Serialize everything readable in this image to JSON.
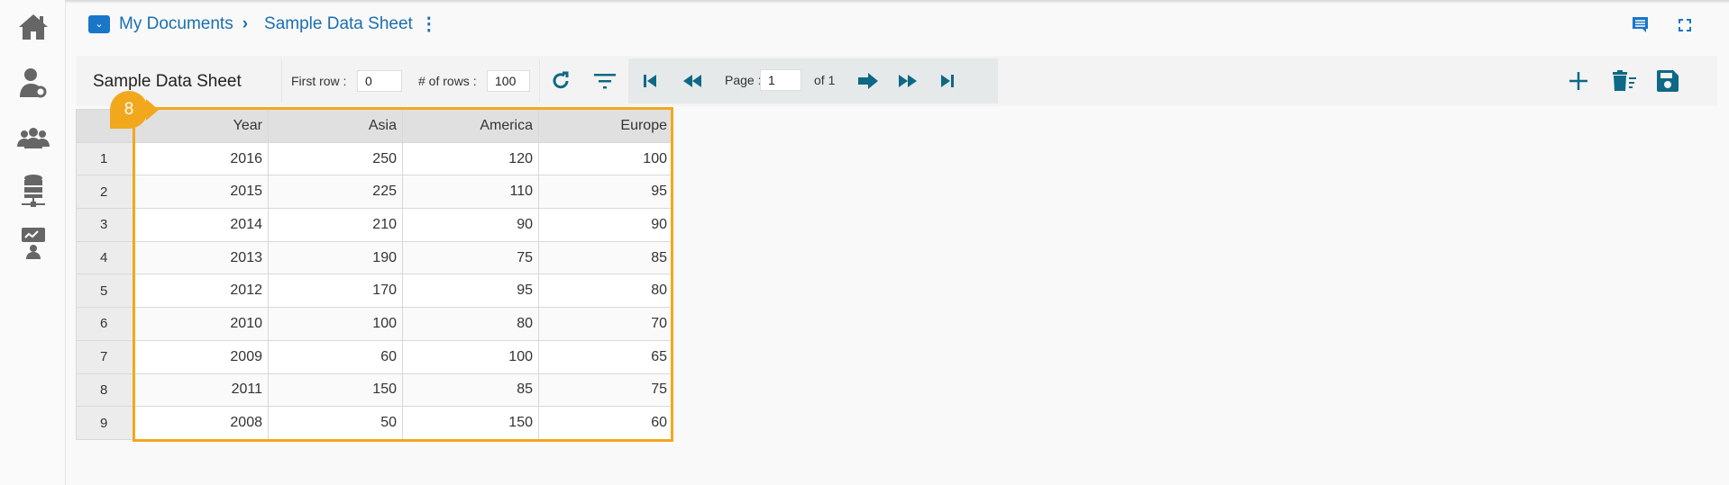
{
  "breadcrumb": {
    "root": "My Documents",
    "current": "Sample Data Sheet"
  },
  "toolbar": {
    "title": "Sample Data Sheet",
    "first_row_label": "First row :",
    "first_row_value": "0",
    "rows_label": "# of rows :",
    "rows_value": "100",
    "page_label": "Page :",
    "page_value": "1",
    "page_of": "of 1"
  },
  "annotation": {
    "badge": "8"
  },
  "table": {
    "columns": [
      "Year",
      "Asia",
      "America",
      "Europe"
    ],
    "rows": [
      [
        "1",
        "2016",
        "250",
        "120",
        "100"
      ],
      [
        "2",
        "2015",
        "225",
        "110",
        "95"
      ],
      [
        "3",
        "2014",
        "210",
        "90",
        "90"
      ],
      [
        "4",
        "2013",
        "190",
        "75",
        "85"
      ],
      [
        "5",
        "2012",
        "170",
        "95",
        "80"
      ],
      [
        "6",
        "2010",
        "100",
        "80",
        "70"
      ],
      [
        "7",
        "2009",
        "60",
        "100",
        "65"
      ],
      [
        "8",
        "2011",
        "150",
        "85",
        "75"
      ],
      [
        "9",
        "2008",
        "50",
        "150",
        "60"
      ]
    ]
  },
  "colors": {
    "accent": "#1b6fae",
    "icon": "#0d6985",
    "highlight": "#f2a81d"
  }
}
